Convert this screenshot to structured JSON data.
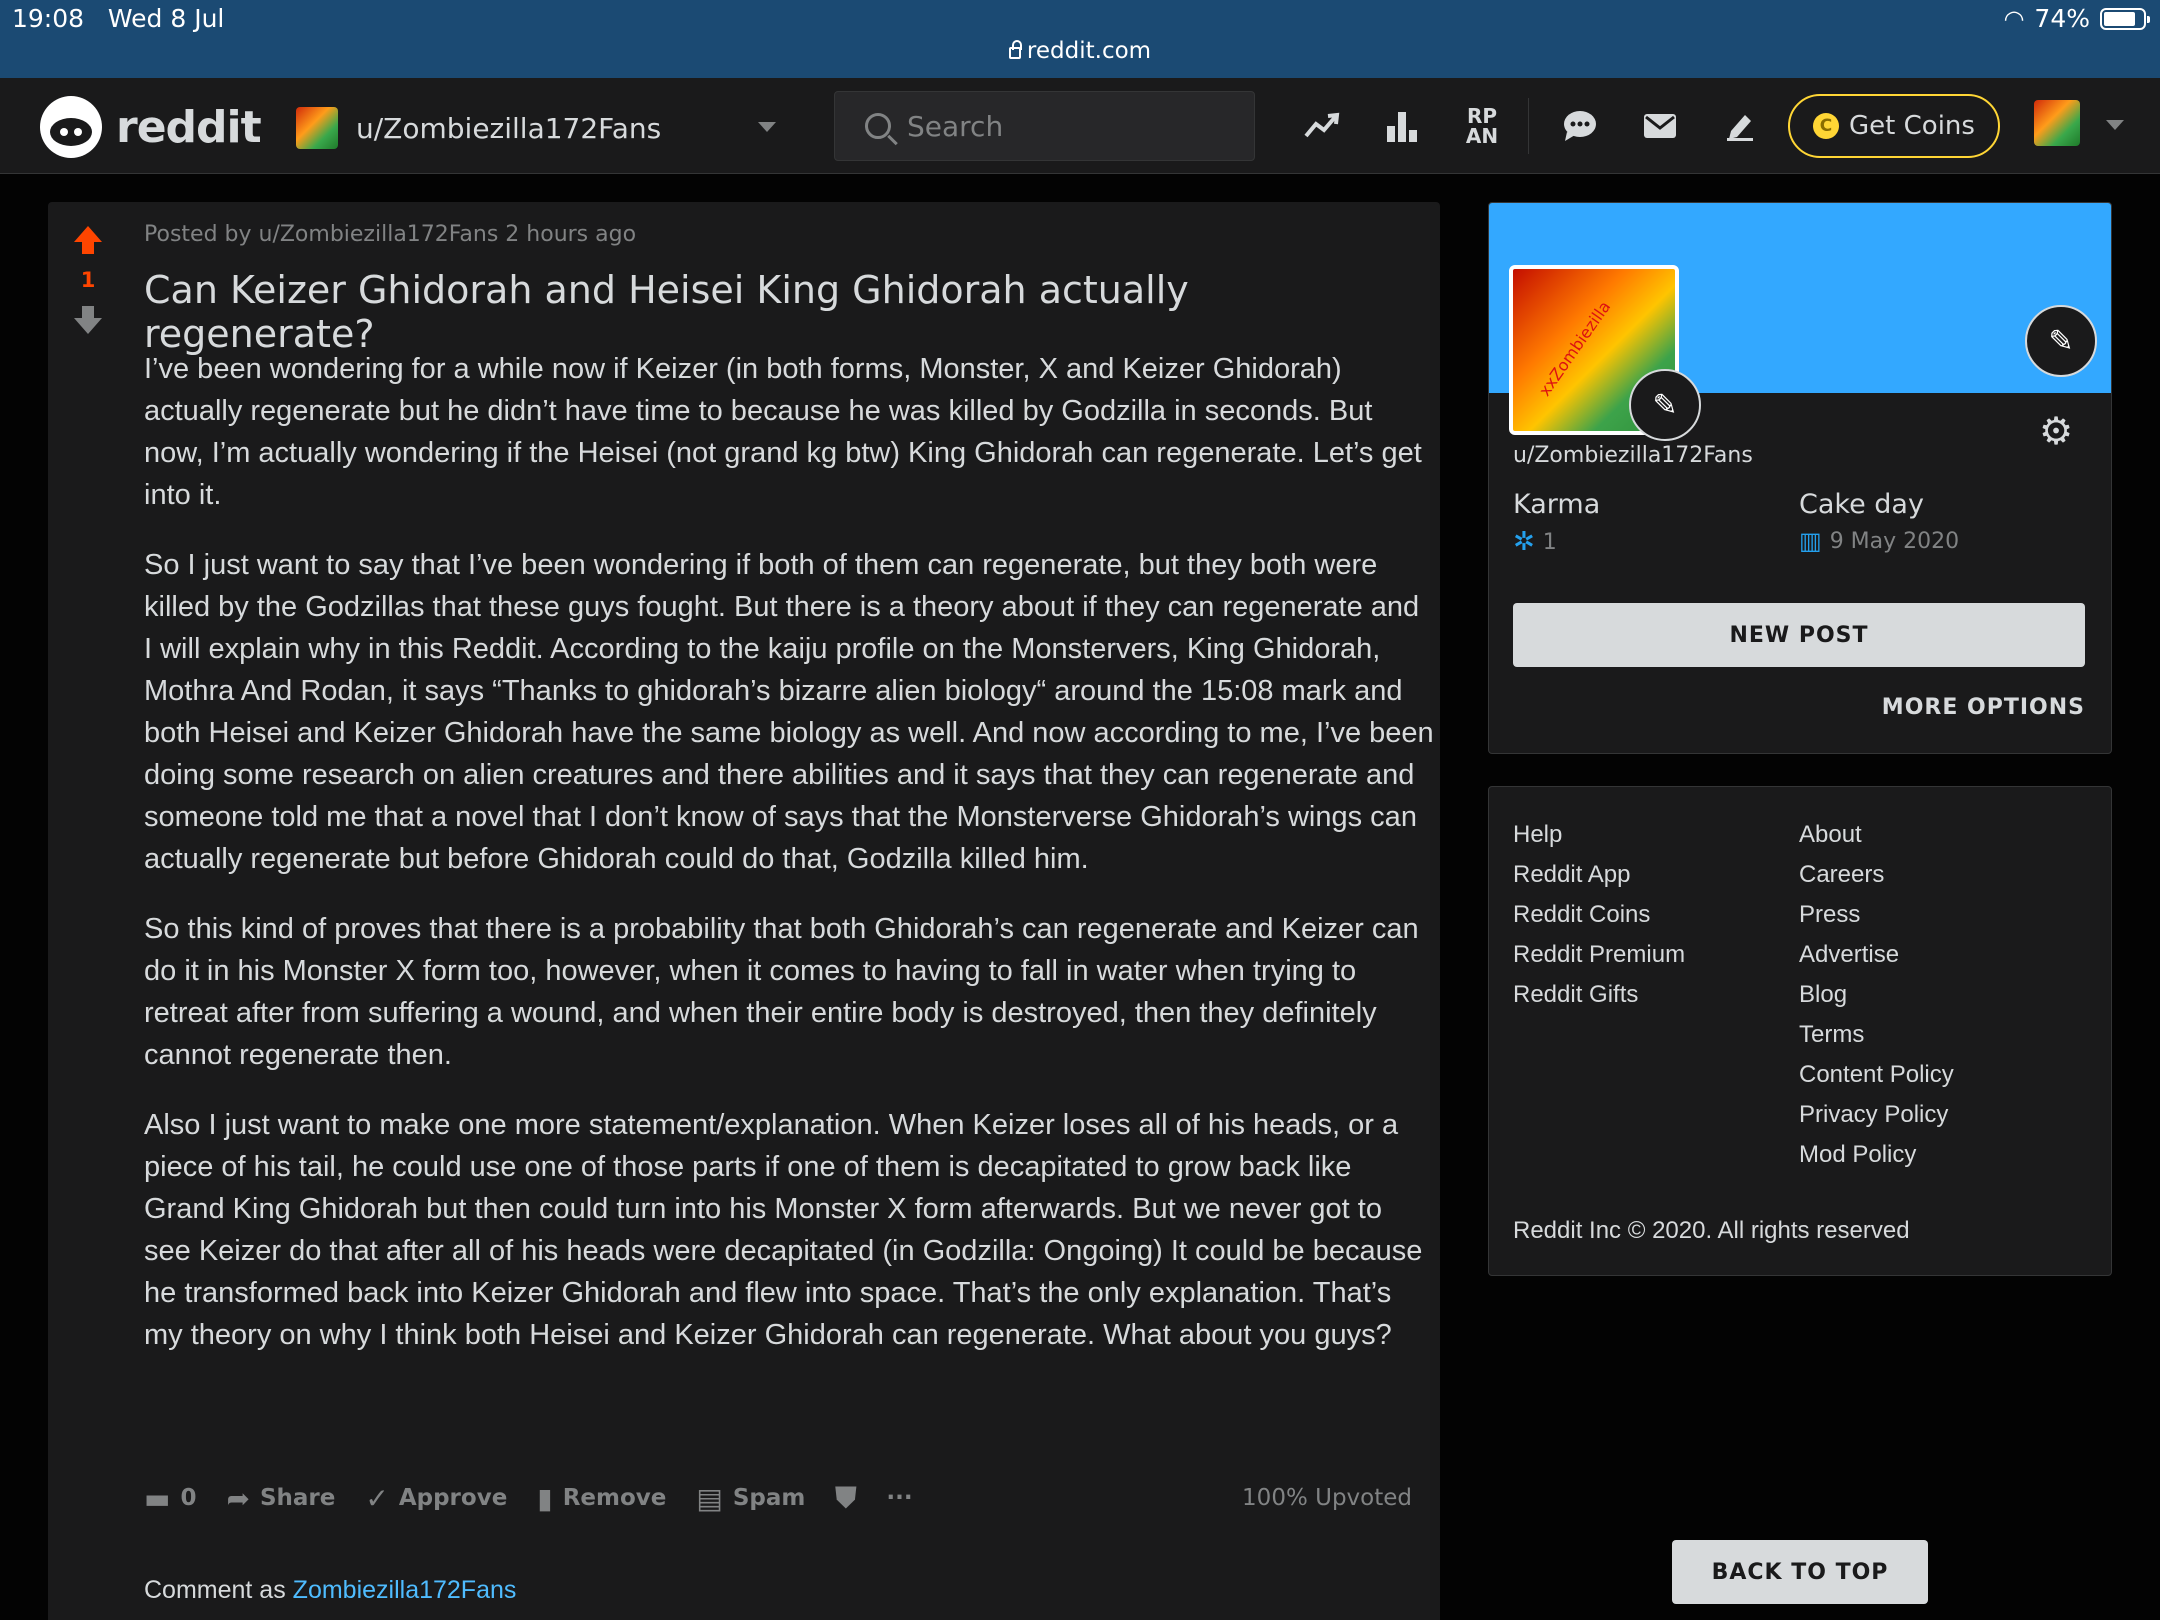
{
  "statusbar": {
    "time": "19:08",
    "date": "Wed 8 Jul",
    "battery": "74%",
    "battery_level": 0.74,
    "url": "reddit.com"
  },
  "header": {
    "logo_text": "reddit",
    "community": "u/Zombiezilla172Fans",
    "search_placeholder": "Search",
    "icons": [
      "trending-icon",
      "leaderboard-icon",
      "rpan-icon",
      "chat-icon",
      "mail-icon",
      "create-post-icon"
    ],
    "rpan_label": "RP\nAN",
    "get_coins": "Get Coins",
    "coin_symbol": "C",
    "accent": "#ffd635"
  },
  "post": {
    "score": "1",
    "meta": "Posted by u/Zombiezilla172Fans 2 hours ago",
    "title": "Can Keizer Ghidorah and Heisei King Ghidorah actually regenerate?",
    "paragraphs": [
      "I’ve been wondering for a while now if Keizer (in both forms, Monster, X and Keizer Ghidorah) actually regenerate but he didn’t have time to because he was killed by Godzilla in seconds. But now, I’m actually wondering if the Heisei (not grand kg btw) King Ghidorah can regenerate. Let’s get into it.",
      "So I just want to say that I’ve been wondering if both of them can regenerate, but they both were killed by the Godzillas that these guys fought. But there is a theory about if they can regenerate and I will explain why in this Reddit. According to the kaiju profile on the Monstervers, King Ghidorah, Mothra And Rodan, it says “Thanks to ghidorah’s bizarre alien biology“ around the 15:08 mark and both Heisei and Keizer Ghidorah have the same biology as well. And now according to me, I’ve been doing some research on alien creatures and there abilities and it says that they can regenerate and someone told me that a novel that I don’t know of says that the Monsterverse Ghidorah’s wings can actually regenerate but before Ghidorah could do that, Godzilla killed him.",
      "So this kind of proves that there is a probability that both Ghidorah’s can regenerate and Keizer can do it in his Monster X form too, however, when it comes to having to fall in water when trying to retreat after from suffering a wound, and when their entire body is destroyed, then they definitely cannot regenerate then.",
      "Also I just want to make one more statement/explanation. When Keizer loses all of his heads, or a piece of his tail, he could use one of those parts if one of them is decapitated to grow back like Grand King Ghidorah but then could turn into his Monster X form afterwards. But we never got to see Keizer do that after all of his heads were decapitated (in Godzilla: Ongoing) It could be because he transformed back into Keizer Ghidorah and flew into space. That’s the only explanation. That’s my theory on why I think both Heisei and Keizer Ghidorah can regenerate. What about you guys?"
    ],
    "actions": {
      "comments": "0",
      "share": "Share",
      "approve": "Approve",
      "remove": "Remove",
      "spam": "Spam",
      "more": "···"
    },
    "upvoted": "100% Upvoted",
    "comment_as_label": "Comment as",
    "comment_as_user": "Zombiezilla172Fans"
  },
  "profile": {
    "username": "u/Zombiezilla172Fans",
    "avatar_watermark": "xxZombiezilla",
    "karma_label": "Karma",
    "karma_value": "1",
    "cakeday_label": "Cake day",
    "cakeday_value": "9 May 2020",
    "new_post": "NEW POST",
    "more_options": "MORE OPTIONS",
    "banner_color": "#33a8ff"
  },
  "footer": {
    "col1": [
      "Help",
      "Reddit App",
      "Reddit Coins",
      "Reddit Premium",
      "Reddit Gifts"
    ],
    "col2": [
      "About",
      "Careers",
      "Press",
      "Advertise",
      "Blog",
      "Terms",
      "Content Policy",
      "Privacy Policy",
      "Mod Policy"
    ],
    "copyright": "Reddit Inc © 2020. All rights reserved"
  },
  "back_to_top": "BACK TO TOP"
}
